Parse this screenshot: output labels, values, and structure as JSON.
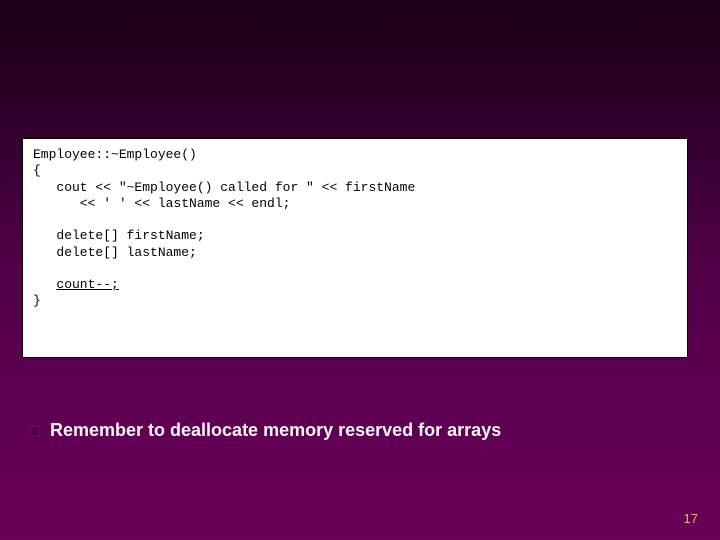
{
  "code": {
    "l1": "Employee::~Employee()",
    "l2": "{",
    "l3": "   cout << \"~Employee() called for \" << firstName",
    "l4": "      << ' ' << lastName << endl;",
    "blank1": "",
    "l5": "   delete[] firstName;",
    "l6": "   delete[] lastName;",
    "blank2": "",
    "l7_indent": "   ",
    "l7_under": "count--;",
    "l8": "}"
  },
  "bullet": {
    "text": "Remember to deallocate memory reserved for arrays"
  },
  "page_number": "17"
}
